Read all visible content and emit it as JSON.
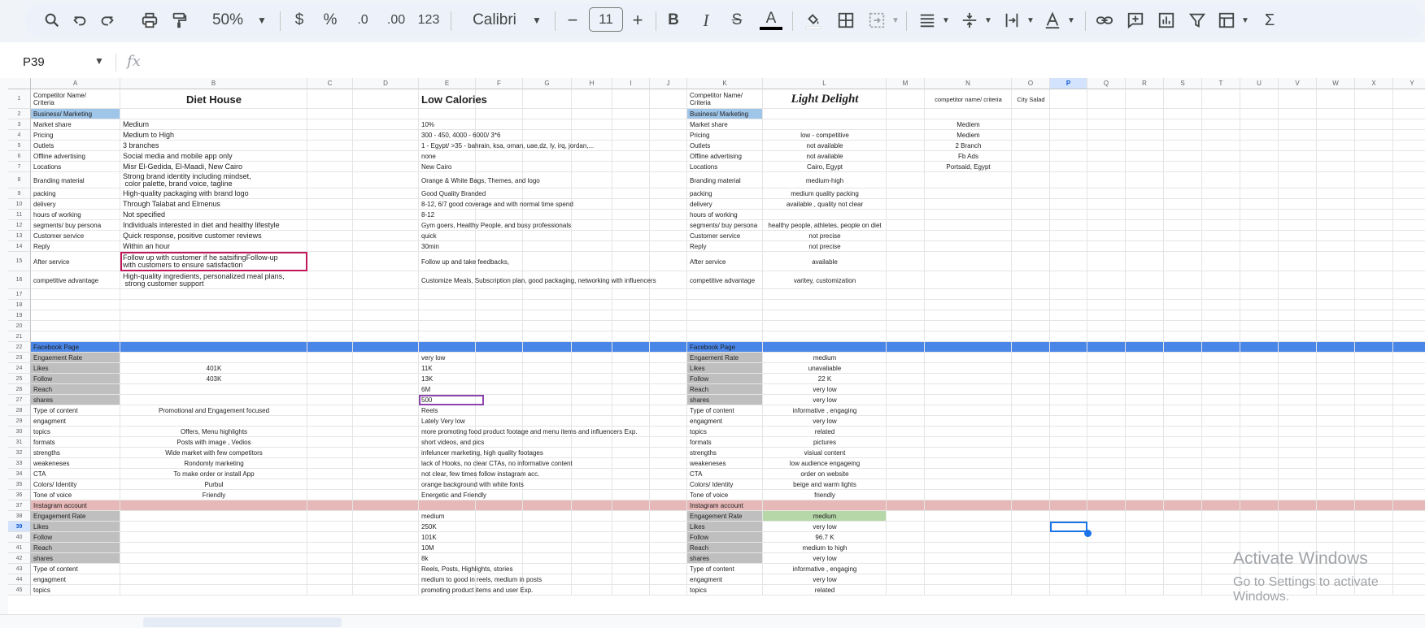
{
  "toolbar": {
    "zoom": "50%",
    "font": "Calibri",
    "font_size": "11",
    "currency": "$",
    "percent": "%",
    "dec_minus": ".0",
    "dec_plus": ".00",
    "number_format": "123",
    "minus": "−",
    "plus": "+",
    "bold": "B",
    "italic": "I",
    "strike": "S",
    "text_color": "A",
    "sigma": "Σ"
  },
  "name_box": "P39",
  "fx_label": "fx",
  "columns": [
    "A",
    "B",
    "C",
    "D",
    "E",
    "F",
    "G",
    "H",
    "I",
    "J",
    "K",
    "L",
    "M",
    "N",
    "O",
    "P",
    "Q",
    "R",
    "S",
    "T",
    "U",
    "V",
    "W",
    "X",
    "Y"
  ],
  "selected_column": "P",
  "selected_row": "39",
  "rows": [
    "1",
    "2",
    "3",
    "4",
    "5",
    "6",
    "7",
    "8",
    "9",
    "10",
    "11",
    "12",
    "13",
    "14",
    "15",
    "16",
    "17",
    "18",
    "19",
    "20",
    "21",
    "22",
    "23",
    "24",
    "25",
    "26",
    "27",
    "28",
    "29",
    "30",
    "31",
    "32",
    "33",
    "34",
    "35",
    "36",
    "37",
    "38",
    "39",
    "40",
    "41",
    "42",
    "43",
    "44",
    "45"
  ],
  "cells": {
    "A1": "Competitor Name/\nCriteria",
    "B1": "Diet House",
    "E1": "Low Calories",
    "K1": "Competitor Name/\nCriteria",
    "L1": "Light Delight",
    "N1": "competitor name/ criteria",
    "O1": "City Salad",
    "A2": "Business/ Marketing",
    "K2": "Business/ Marketing",
    "A3": "Market share",
    "B3": "Medium",
    "E3": "10%",
    "K3": "Market share",
    "N3": "Mediem",
    "A4": "Pricing",
    "B4": "Medium to High",
    "E4": "300 - 450, 4000 - 6000/ 3*6",
    "K4": "Pricing",
    "L4": "low - competitive",
    "N4": "Mediem",
    "A5": "Outlets",
    "B5": "3 branches",
    "E5": "1 - Egypt/ >35 - bahrain, ksa, oman, uae,dz, ly, irq, jordan,...",
    "K5": "Outlets",
    "L5": "not available",
    "N5": "2 Branch",
    "A6": "Offline advertising",
    "B6": "Social media and mobile app only",
    "E6": "none",
    "K6": "Offline advertising",
    "L6": "not available",
    "N6": "Fb Ads",
    "A7": "Locations",
    "B7": "Misr El-Gedida, El-Maadi, New Cairo",
    "E7": "New Cairo",
    "K7": "Locations",
    "L7": "Cairo, Egypt",
    "N7": "Portsaid, Egypt",
    "A8": "Branding material",
    "B8": "Strong brand identity including mindset,\n color palette, brand voice, tagline",
    "E8": "Orange & White Bags, Themes, and logo",
    "K8": "Branding material",
    "L8": "medium-high",
    "A9": "packing",
    "B9": "High-quality packaging with brand logo",
    "E9": "Good Quality Branded",
    "K9": "packing",
    "L9": "medium quality packing",
    "A10": "delivery",
    "B10": "Through Talabat and Elmenus",
    "E10": "8-12, 6/7 good coverage and with normal time spend",
    "K10": "delivery",
    "L10": "available , quality not clear",
    "A11": "hours of working",
    "B11": "Not specified",
    "E11": "8-12",
    "K11": "hours of working",
    "A12": "segments/ buy persona",
    "B12": "Individuals interested in diet and healthy lifestyle",
    "E12": "Gym goers, Healthy People, and busy professionals",
    "K12": "segments/ buy persona",
    "L12": "healthy people, athletes, people on diet",
    "A13": "Customer service",
    "B13": "Quick response, positive customer reviews",
    "E13": "quick",
    "K13": "Customer service",
    "L13": "not  precise",
    "A14": "Reply",
    "B14": "Within an hour",
    "E14": "30min",
    "K14": "Reply",
    "L14": "not  precise",
    "A15": "After service",
    "B15": "Follow up with customer if he satsifingFollow-up\nwith customers to ensure satisfaction",
    "E15": "Follow up and take feedbacks,",
    "K15": "After service",
    "L15": "available",
    "A16": "competitive advantage",
    "B16": "High-quality ingredients, personalized meal plans,\n strong customer support",
    "E16": "Customize Meals, Subscription plan, good packaging, networking with influencers",
    "K16": "competitive advantage",
    "L16": "varitey, customization",
    "A22": "Facebook Page",
    "K22": "Facebook Page",
    "A23": "Engaement Rate",
    "E23": "very low",
    "K23": "Engaement Rate",
    "L23": "medium",
    "A24": "Likes",
    "B24": "401K",
    "E24": "11K",
    "K24": "Likes",
    "L24": "unavaliable",
    "A25": "Follow",
    "B25": "403K",
    "E25": "13K",
    "K25": "Follow",
    "L25": "22 K",
    "A26": "Reach",
    "E26": "6M",
    "K26": "Reach",
    "L26": "very low",
    "A27": "shares",
    "E27": "500",
    "K27": "shares",
    "L27": "very low",
    "A28": "Type of content",
    "B28": "Promotional and Engagement focused",
    "E28": "Reels",
    "K28": "Type of content",
    "L28": "informative , engaging",
    "A29": "engagment",
    "E29": "Lately Very low",
    "K29": "engagment",
    "L29": "very low",
    "A30": "topics",
    "B30": "Offers, Menu highlights",
    "E30": "more promoting food product footage and menu items and influencers Exp.",
    "K30": "topics",
    "L30": "related",
    "A31": "formats",
    "B31": "Posts with image , Vedios",
    "E31": "short videos, and pics",
    "K31": "formats",
    "L31": "pictures",
    "A32": "strengths",
    "B32": "Wide market with few competitors",
    "E32": "infeluncer marketing, high quality footages",
    "K32": "strengths",
    "L32": "visiual content",
    "A33": "weakeneses",
    "B33": "Rondomly marketing",
    "E33": "lack of Hooks, no clear CTAs, no informative content",
    "K33": "weakeneses",
    "L33": "low audience engageing",
    "A34": "CTA",
    "B34": "To make order or install App",
    "E34": "not clear, few times follow instagram acc.",
    "K34": "CTA",
    "L34": "order on website",
    "A35": "Colors/ Identity",
    "B35": "Purbul",
    "E35": "orange background with white fonts",
    "K35": "Colors/ Identity",
    "L35": "beige and warm lights",
    "A36": "Tone of voice",
    "B36": "Friendly",
    "E36": "Energetic and Friendly",
    "K36": "Tone of voice",
    "L36": "friendly",
    "A37": "Instagram account",
    "K37": "Instagram account",
    "A38": "Engagement Rate",
    "E38": "medium",
    "K38": "Engagement Rate",
    "L38": "medium",
    "A39": "Likes",
    "E39": "250K",
    "K39": "Likes",
    "L39": "very low",
    "A40": "Follow",
    "E40": "101K",
    "K40": "Follow",
    "L40": "96.7 K",
    "A41": "Reach",
    "E41": "10M",
    "K41": "Reach",
    "L41": "medium to high",
    "A42": "shares",
    "E42": "8k",
    "K42": "shares",
    "L42": "very low",
    "A43": "Type of content",
    "E43": "Reels, Posts, Highlights, stories",
    "K43": "Type of content",
    "L43": "informative , engaging",
    "A44": "engagment",
    "E44": "medium to good in reels, medium in posts",
    "K44": "engagment",
    "L44": "very low",
    "A45": "topics",
    "E45": "promoting product items and user Exp.",
    "K45": "topics",
    "L45": "related"
  },
  "watermark": {
    "title": "Activate Windows",
    "subtitle": "Go to Settings to activate Windows."
  },
  "colors": {
    "facebook_row": "#4a86e8",
    "instagram_row": "#e6b8b7",
    "business_header": "#9fc5e8",
    "label_gray": "#bfbfbf",
    "green_cell": "#b6d7a8",
    "pink_border": "#c2185b",
    "purple_border": "#8e44ad",
    "selection": "#1a73e8"
  }
}
